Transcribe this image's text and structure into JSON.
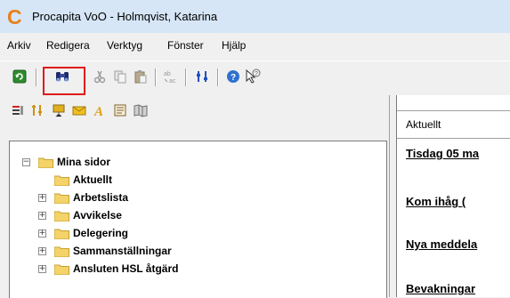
{
  "window": {
    "title": "Procapita VoO - Holmqvist, Katarina"
  },
  "menubar": {
    "items": [
      "Arkiv",
      "Redigera",
      "Verktyg",
      "Fönster",
      "Hjälp"
    ]
  },
  "toolbar": {
    "buttons": [
      "refresh-icon",
      "binoculars-search-icon",
      "cut-icon",
      "copy-icon",
      "paste-icon",
      "spellcheck-icon",
      "filter-icon",
      "help-icon",
      "whats-this-icon"
    ],
    "highlight_color": "#e21a1a"
  },
  "left_pane": {
    "toolbar_icons": [
      "list-icon",
      "tools-icon",
      "presentation-icon",
      "mail-icon",
      "text-icon",
      "document-icon",
      "map-icon"
    ],
    "tree": [
      {
        "label": "Mina sidor",
        "expander": "−"
      },
      {
        "label": "Aktuellt",
        "expander": ""
      },
      {
        "label": "Arbetslista",
        "expander": "+"
      },
      {
        "label": "Avvikelse",
        "expander": "+"
      },
      {
        "label": "Delegering",
        "expander": "+"
      },
      {
        "label": "Sammanställningar",
        "expander": "+"
      },
      {
        "label": "Ansluten HSL åtgärd",
        "expander": "+"
      }
    ]
  },
  "right_pane": {
    "tab_label": "Aktuellt",
    "headings": [
      "Tisdag 05 ma",
      "Kom ihåg   (",
      "Nya meddela",
      "Bevakningar"
    ]
  }
}
